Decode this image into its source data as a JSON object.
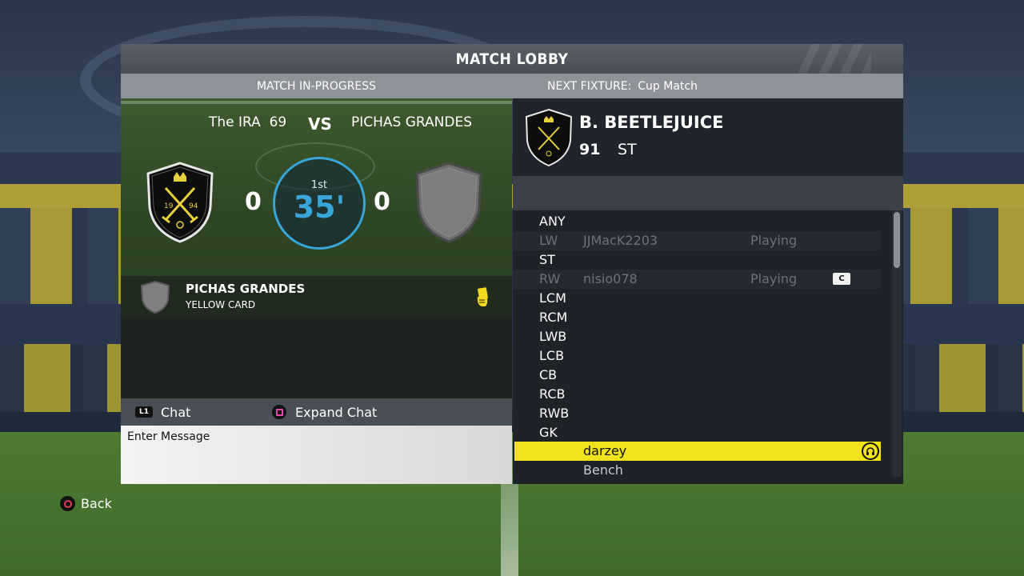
{
  "header": {
    "title": "MATCH LOBBY"
  },
  "match_panel": {
    "status": "MATCH IN-PROGRESS",
    "home_team": "The IRA  69",
    "vs": "VS",
    "away_team": "PICHAS GRANDES",
    "home_score": "0",
    "away_score": "0",
    "half": "1st",
    "minute": "35'",
    "crest_years": [
      "19",
      "94"
    ]
  },
  "event": {
    "team": "PICHAS GRANDES",
    "type": "YELLOW CARD",
    "icon": "yellow-card-icon"
  },
  "fixture": {
    "label": "NEXT FIXTURE:",
    "value": "Cup Match"
  },
  "player": {
    "name": "B. BEETLEJUICE",
    "rating": "91",
    "position": "ST"
  },
  "positions": [
    {
      "pos": "ANY",
      "name": "",
      "status": ""
    },
    {
      "pos": "LW",
      "name": "JJMacK2203",
      "status": "Playing"
    },
    {
      "pos": "ST",
      "name": "",
      "status": ""
    },
    {
      "pos": "RW",
      "name": "nisio078",
      "status": "Playing",
      "badge": "C"
    },
    {
      "pos": "LCM",
      "name": "",
      "status": ""
    },
    {
      "pos": "RCM",
      "name": "",
      "status": ""
    },
    {
      "pos": "LWB",
      "name": "",
      "status": ""
    },
    {
      "pos": "LCB",
      "name": "",
      "status": ""
    },
    {
      "pos": "CB",
      "name": "",
      "status": ""
    },
    {
      "pos": "RCB",
      "name": "",
      "status": ""
    },
    {
      "pos": "RWB",
      "name": "",
      "status": ""
    },
    {
      "pos": "GK",
      "name": "",
      "status": ""
    },
    {
      "pos": "",
      "name": "darzey",
      "status": ""
    },
    {
      "pos": "",
      "name": "Bench",
      "status": ""
    }
  ],
  "chat": {
    "chat_label": "Chat",
    "l1_label": "L1",
    "expand_label": "Expand Chat",
    "placeholder": "Enter Message"
  },
  "footer": {
    "back_label": "Back"
  },
  "colors": {
    "accent_blue": "#38a6d9",
    "highlight_yellow": "#f0e21b",
    "crest_gold": "#e7d13a"
  }
}
